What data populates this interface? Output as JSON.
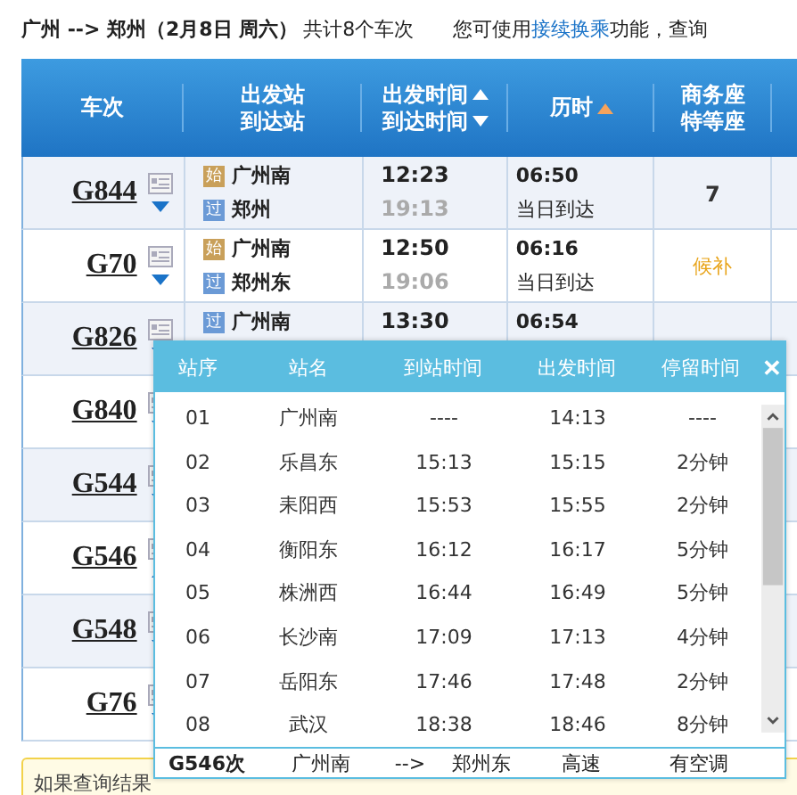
{
  "title": {
    "route": "广州 --> 郑州（2月8日  周六）",
    "count": "共计8个车次",
    "hint_before": "您可使用",
    "hint_link": "接续换乘",
    "hint_after": "功能，查询"
  },
  "table": {
    "columns": [
      {
        "lines": [
          "车次"
        ]
      },
      {
        "lines": [
          "出发站",
          "到达站"
        ]
      },
      {
        "lines": [
          "出发时间",
          "到达时间"
        ],
        "sorted": false
      },
      {
        "lines": [
          "历时"
        ],
        "sorted": true
      },
      {
        "lines": [
          "商务座",
          "特等座"
        ]
      }
    ],
    "rows": [
      {
        "train": "G844",
        "expanded": false,
        "from_tag": {
          "text": "始",
          "kind": "start"
        },
        "from": "广州南",
        "to_tag": {
          "text": "过",
          "kind": "pass"
        },
        "to": "郑州",
        "depart": "12:23",
        "arrive": "19:13",
        "duration": "06:50",
        "arrival_day": "当日到达",
        "seat": {
          "text": "7",
          "kind": "count"
        }
      },
      {
        "train": "G70",
        "expanded": false,
        "from_tag": {
          "text": "始",
          "kind": "start"
        },
        "from": "广州南",
        "to_tag": {
          "text": "过",
          "kind": "pass"
        },
        "to": "郑州东",
        "depart": "12:50",
        "arrive": "19:06",
        "duration": "06:16",
        "arrival_day": "当日到达",
        "seat": {
          "text": "候补",
          "kind": "waitlist"
        }
      },
      {
        "train": "G826",
        "expanded": false,
        "from_tag": {
          "text": "过",
          "kind": "pass"
        },
        "from": "广州南",
        "depart": "13:30",
        "duration": "06:54"
      },
      {
        "train": "G840",
        "expanded": false
      },
      {
        "train": "G544",
        "expanded": false
      },
      {
        "train": "G546",
        "expanded": true
      },
      {
        "train": "G548",
        "expanded": false
      },
      {
        "train": "G76",
        "expanded": false
      }
    ]
  },
  "stops_popup": {
    "columns": [
      "站序",
      "站名",
      "到站时间",
      "出发时间",
      "停留时间"
    ],
    "close": "✕",
    "stops": [
      [
        "01",
        "广州南",
        "----",
        "14:13",
        "----"
      ],
      [
        "02",
        "乐昌东",
        "15:13",
        "15:15",
        "2分钟"
      ],
      [
        "03",
        "耒阳西",
        "15:53",
        "15:55",
        "2分钟"
      ],
      [
        "04",
        "衡阳东",
        "16:12",
        "16:17",
        "5分钟"
      ],
      [
        "05",
        "株洲西",
        "16:44",
        "16:49",
        "5分钟"
      ],
      [
        "06",
        "长沙南",
        "17:09",
        "17:13",
        "4分钟"
      ],
      [
        "07",
        "岳阳东",
        "17:46",
        "17:48",
        "2分钟"
      ],
      [
        "08",
        "武汉",
        "18:38",
        "18:46",
        "8分钟"
      ]
    ],
    "footer": {
      "train": "G546次",
      "from": "广州南",
      "arrow": "-->",
      "to": "郑州东",
      "type": "高速",
      "ac": "有空调"
    }
  },
  "notice": "如果查询结果"
}
